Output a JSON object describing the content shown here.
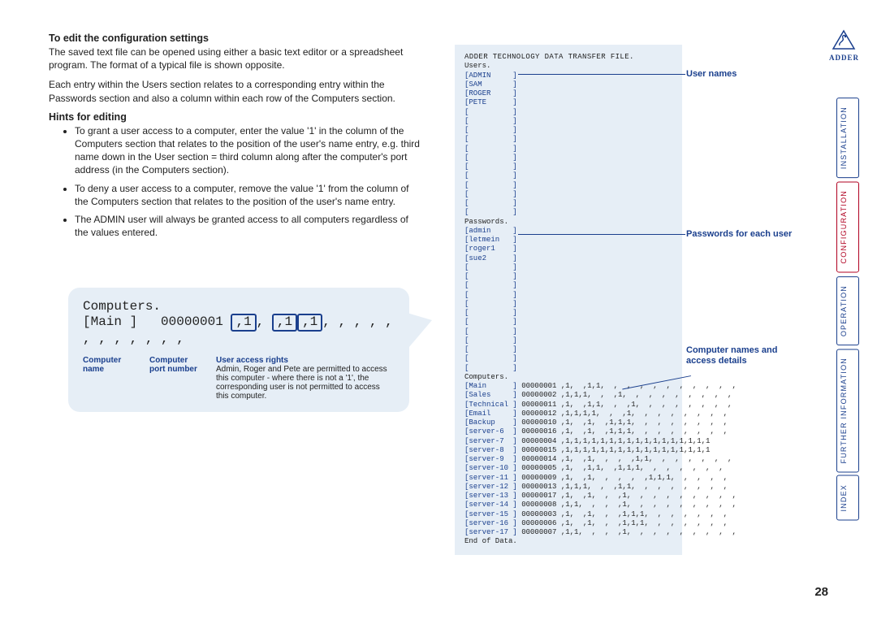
{
  "headings": {
    "edit_config": "To edit the configuration settings",
    "hints": "Hints for editing"
  },
  "paragraphs": {
    "p1": "The saved text file can be opened using either a basic text editor or a spreadsheet program. The format of a typical file is shown opposite.",
    "p2": "Each entry within the Users section relates to a corresponding entry within the Passwords section and also a column within each row of the Computers section."
  },
  "hints": [
    "To grant a user access to a computer, enter the value '1' in the column of the Computers section that relates to the position of the user's name entry, e.g. third name down in the User section = third column along after the computer's port address (in the Computers section).",
    "To deny a user access to a computer, remove the value '1' from the column of the Computers section that relates to the position of the user's name entry.",
    "The ADMIN user will always be granted access to all computers regardless of the values entered."
  ],
  "callout": {
    "title": "Computers.",
    "name": "[Main     ]",
    "port": "00000001",
    "bits": [
      ",1",
      ", ",
      ",1",
      ",1",
      ",  ,  ,  ,  ,  ,  ,  ,  ,  ,  ,  ,"
    ],
    "labels": {
      "computer_name": "Computer name",
      "computer_port": "Computer port number",
      "user_access": "User access rights",
      "user_access_desc": "Admin, Roger and Pete are permitted to access this computer - where there is not a '1', the corresponding user is not permitted to access this computer."
    }
  },
  "datafile": {
    "header": "ADDER TECHNOLOGY DATA TRANSFER FILE.",
    "users_head": "Users.",
    "users": [
      "ADMIN",
      "SAM",
      "ROGER",
      "PETE"
    ],
    "passwords_head": "Passwords.",
    "passwords": [
      "admin",
      "letmein",
      "roger1",
      "sue2"
    ],
    "computers_head": "Computers.",
    "computers": [
      {
        "name": "Main",
        "port": "00000001",
        "bits": ",1,  ,1,1,  ,  ,  ,  ,  ,  ,  ,  ,  ,  ,"
      },
      {
        "name": "Sales",
        "port": "00000002",
        "bits": ",1,1,1,  ,  ,1,  ,  ,  ,  ,  ,  ,  ,  ,"
      },
      {
        "name": "Technical",
        "port": "00000011",
        "bits": ",1,  ,1,1,  ,  ,1,  ,  ,  ,  ,  ,  ,  ,"
      },
      {
        "name": "Email",
        "port": "00000012",
        "bits": ",1,1,1,1,  ,  ,1,  ,  ,  ,  ,  ,  ,  ,"
      },
      {
        "name": "Backup",
        "port": "00000010",
        "bits": ",1,  ,1,  ,1,1,1,  ,  ,  ,  ,  ,  ,  ,"
      },
      {
        "name": "server-6",
        "port": "00000016",
        "bits": ",1,  ,1,  ,1,1,1,  ,  ,  ,  ,  ,  ,  ,"
      },
      {
        "name": "server-7",
        "port": "00000004",
        "bits": ",1,1,1,1,1,1,1,1,1,1,1,1,1,1,1,1,1"
      },
      {
        "name": "server-8",
        "port": "00000015",
        "bits": ",1,1,1,1,1,1,1,1,1,1,1,1,1,1,1,1,1"
      },
      {
        "name": "server-9",
        "port": "00000014",
        "bits": ",1,  ,1,  ,  ,  ,1,1,  ,  ,  ,  ,  ,  ,"
      },
      {
        "name": "server-10",
        "port": "00000005",
        "bits": ",1,  ,1,1,  ,1,1,1,  ,  ,  ,  ,  ,  ,"
      },
      {
        "name": "server-11",
        "port": "00000009",
        "bits": ",1,  ,1,  ,  ,  ,  ,1,1,1,  ,  ,  ,  ,"
      },
      {
        "name": "server-12",
        "port": "00000013",
        "bits": ",1,1,1,  ,  ,1,1,  ,  ,  ,  ,  ,  ,  ,"
      },
      {
        "name": "server-13",
        "port": "00000017",
        "bits": ",1,  ,1,  ,  ,1,  ,  ,  ,  ,  ,  ,  ,  ,"
      },
      {
        "name": "server-14",
        "port": "00000008",
        "bits": ",1,1,  ,  ,  ,1,  ,  ,  ,  ,  ,  ,  ,  ,"
      },
      {
        "name": "server-15",
        "port": "00000003",
        "bits": ",1,  ,1,  ,  ,1,1,1,  ,  ,  ,  ,  ,  ,"
      },
      {
        "name": "server-16",
        "port": "00000006",
        "bits": ",1,  ,1,  ,  ,1,1,1,  ,  ,  ,  ,  ,  ,"
      },
      {
        "name": "server-17",
        "port": "00000007",
        "bits": ",1,1,  ,  ,  ,1,  ,  ,  ,  ,  ,  ,  ,  ,"
      }
    ],
    "footer": "End of Data."
  },
  "side_labels": {
    "user_names": "User names",
    "passwords": "Passwords for each user",
    "computers": "Computer names and access details"
  },
  "sidenav": {
    "installation": "INSTALLATION",
    "configuration": "CONFIGURATION",
    "operation": "OPERATION",
    "further": "FURTHER INFORMATION",
    "index": "INDEX"
  },
  "brand": "ADDER",
  "page": "28"
}
